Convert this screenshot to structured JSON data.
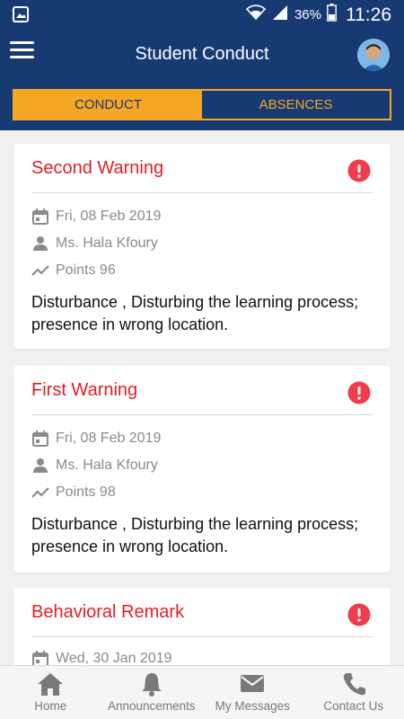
{
  "status_bar": {
    "battery_pct": "36%",
    "time": "11:26"
  },
  "app_bar": {
    "title": "Student Conduct"
  },
  "tabs": [
    {
      "label": "CONDUCT",
      "active": true
    },
    {
      "label": "ABSENCES",
      "active": false
    }
  ],
  "cards": [
    {
      "title": "Second Warning",
      "date": "Fri, 08 Feb 2019",
      "teacher": "Ms. Hala Kfoury",
      "points": "Points 96",
      "description": "Disturbance , Disturbing the learning process; presence in wrong location."
    },
    {
      "title": "First Warning",
      "date": "Fri, 08 Feb 2019",
      "teacher": "Ms. Hala Kfoury",
      "points": "Points 98",
      "description": "Disturbance , Disturbing the learning process; presence in wrong location."
    },
    {
      "title": "Behavioral Remark",
      "date": "Wed, 30 Jan 2019"
    }
  ],
  "bottom_nav": [
    {
      "label": "Home",
      "icon": "home-icon"
    },
    {
      "label": "Announcements",
      "icon": "bell-icon"
    },
    {
      "label": "My Messages",
      "icon": "mail-icon"
    },
    {
      "label": "Contact Us",
      "icon": "phone-icon"
    }
  ],
  "colors": {
    "primary": "#173a73",
    "accent": "#f5a623",
    "warning": "#e31e24",
    "alert_icon": "#f03c4b"
  }
}
